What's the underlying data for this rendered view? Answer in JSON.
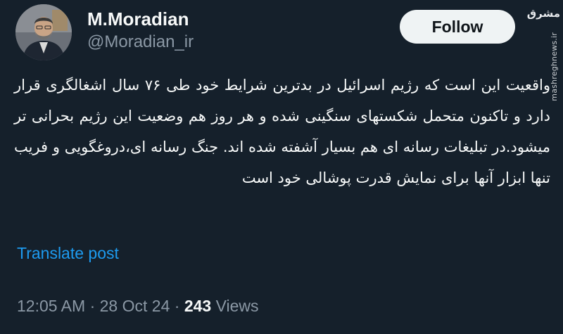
{
  "author": {
    "name": "M.Moradian",
    "handle": "@Moradian_ir"
  },
  "follow_label": "Follow",
  "watermark": {
    "logo": "مشرق",
    "url": "mashreghnews.ir"
  },
  "tweet": {
    "text": "واقعیت این است که رژیم اسرائیل در بدترین شرایط خود طی ۷۶ سال اشغالگری قرار دارد و تاکنون متحمل شکستهای سنگینی شده و هر روز هم وضعیت این رژیم بحرانی تر میشود.در تبلیغات رسانه ای هم بسیار آشفته شده اند. جنگ رسانه ای،دروغگویی و فریب تنها ابزار آنها برای نمایش قدرت پوشالی خود است"
  },
  "translate_label": "Translate post",
  "meta": {
    "time": "12:05 AM",
    "separator": "·",
    "date": "28 Oct 24",
    "views_count": "243",
    "views_label": "Views"
  },
  "colors": {
    "background": "#15202b",
    "text": "#f7f9f9",
    "muted": "#8b98a5",
    "link": "#1d9bf0",
    "follow_bg": "#eff3f4"
  }
}
